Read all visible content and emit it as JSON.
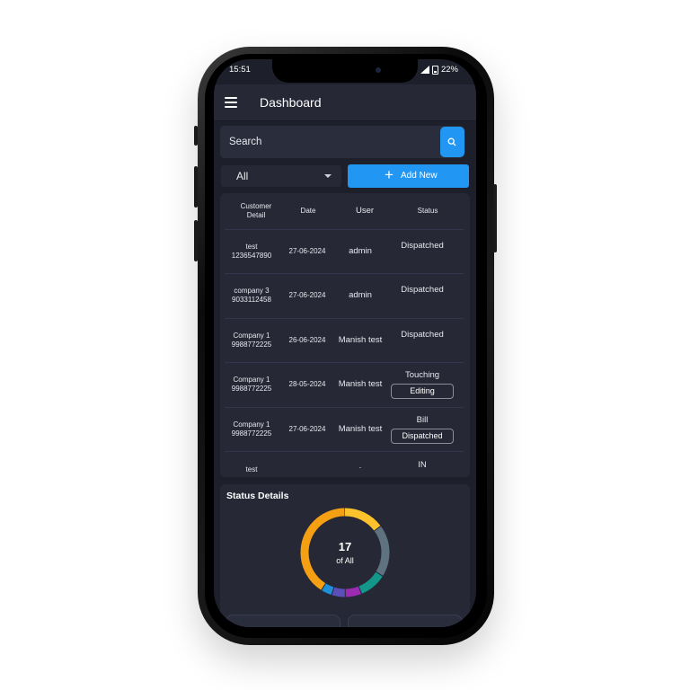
{
  "status_bar": {
    "time": "15:51",
    "battery": "22%"
  },
  "app_bar": {
    "title": "Dashboard"
  },
  "search": {
    "placeholder": "Search"
  },
  "filter": {
    "selected": "All"
  },
  "add_button": {
    "label": "Add New"
  },
  "table": {
    "headers": {
      "customer": "Customer\nDetail",
      "date": "Date",
      "user": "User",
      "status": "Status"
    },
    "rows": [
      {
        "customer_name": "test",
        "customer_phone": "1236547890",
        "date": "27-06-2024",
        "user": "admin",
        "status": "Dispatched",
        "chip": ""
      },
      {
        "customer_name": "company 3",
        "customer_phone": "9033112458",
        "date": "27-06-2024",
        "user": "admin",
        "status": "Dispatched",
        "chip": ""
      },
      {
        "customer_name": "Company 1",
        "customer_phone": "9988772225",
        "date": "26-06-2024",
        "user": "Manish test",
        "status": "Dispatched",
        "chip": ""
      },
      {
        "customer_name": "Company 1",
        "customer_phone": "9988772225",
        "date": "28-05-2024",
        "user": "Manish test",
        "status": "Touching",
        "chip": "Editing"
      },
      {
        "customer_name": "Company 1",
        "customer_phone": "9988772225",
        "date": "27-06-2024",
        "user": "Manish test",
        "status": "Bill",
        "chip": "Dispatched"
      },
      {
        "customer_name": "test",
        "customer_phone": "",
        "date": "",
        "user": ".",
        "status": "IN",
        "chip": ""
      }
    ]
  },
  "status_details": {
    "title": "Status Details",
    "count": "17",
    "sub": "of All",
    "segments": [
      {
        "share": 0.15,
        "color": "#fcc22d"
      },
      {
        "share": 0.19,
        "color": "#5f7280"
      },
      {
        "share": 0.1,
        "color": "#12978a"
      },
      {
        "share": 0.06,
        "color": "#9b2bb0"
      },
      {
        "share": 0.05,
        "color": "#5b4fb8"
      },
      {
        "share": 0.04,
        "color": "#1f8fd8"
      },
      {
        "share": 0.41,
        "color": "#f59f12"
      }
    ]
  }
}
